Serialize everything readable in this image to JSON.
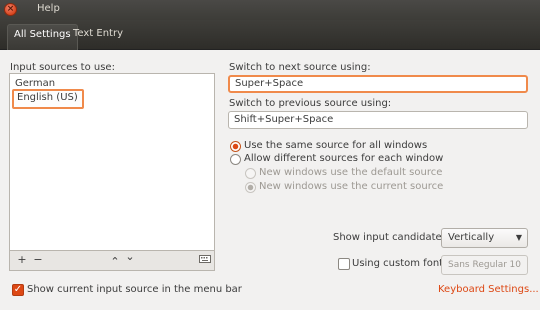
{
  "window": {
    "title": "Help",
    "close_glyph": "×"
  },
  "tabs": [
    {
      "label": "All Settings",
      "active": true
    },
    {
      "label": "Text Entry",
      "active": false
    }
  ],
  "sources": {
    "label": "Input sources to use:",
    "items": [
      "German",
      "English (US)"
    ],
    "selected": "English (US)",
    "toolbar": {
      "add": "+",
      "remove": "−",
      "up": "⌃",
      "down": "⌄",
      "keyboard_icon": "keyboard-icon"
    }
  },
  "switch_next": {
    "label": "Switch to next source using:",
    "value": "Super+Space"
  },
  "switch_prev": {
    "label": "Switch to previous source using:",
    "value": "Shift+Super+Space"
  },
  "options": {
    "same_source": "Use the same source for all windows",
    "different_sources": "Allow different sources for each window",
    "default_source": "New windows use the default source",
    "current_source": "New windows use the current source",
    "selected": "same_source",
    "sub_selected": "current_source"
  },
  "candidates": {
    "label": "Show input candidates:",
    "value": "Vertically"
  },
  "custom_font": {
    "label": "Using custom font:",
    "checked": false,
    "font_name": "Sans Regular",
    "font_size": "10"
  },
  "show_in_menu": {
    "label": "Show current input source in the menu bar",
    "checked": true
  },
  "keyboard_settings_link": "Keyboard Settings...",
  "colors": {
    "accent": "#dd4814",
    "highlight": "#f08a4b",
    "titlebar": "#3d3c38",
    "background": "#f2f1f0"
  }
}
